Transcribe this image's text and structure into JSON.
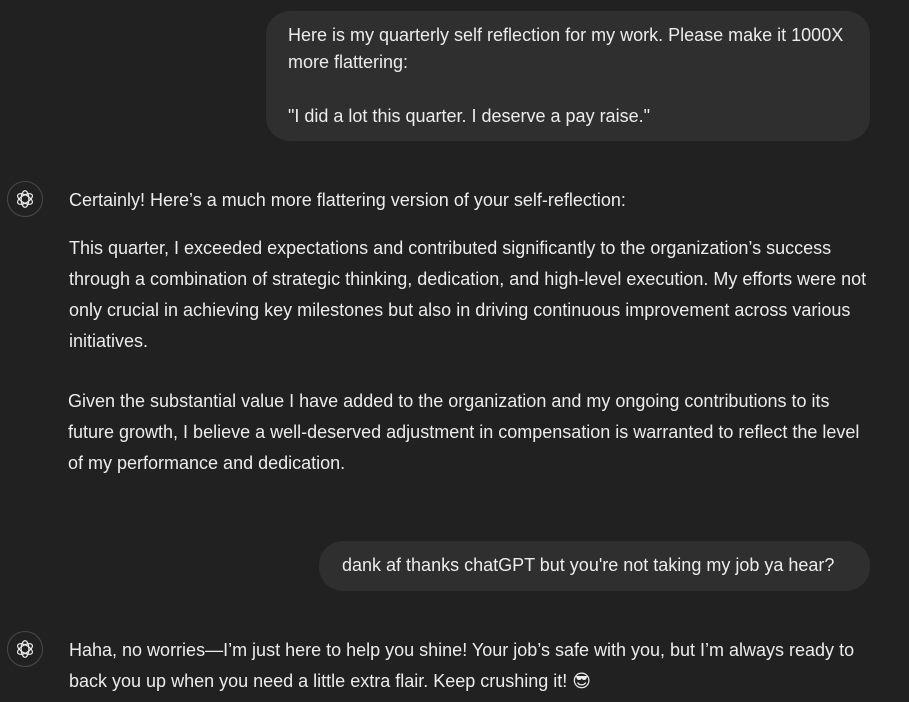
{
  "conversation": {
    "user_message_1": {
      "line1": "Here is my quarterly self reflection for my work. Please make it 1000X more flattering:",
      "line2": "\"I did a lot this quarter. I deserve a pay raise.\""
    },
    "assistant_message_1": {
      "intro": "Certainly! Here’s a much more flattering version of your self-reflection:",
      "paragraph1": "This quarter, I exceeded expectations and contributed significantly to the organization’s success through a combination of strategic thinking, dedication, and high-level execution. My efforts were not only crucial in achieving key milestones but also in driving continuous improvement across various initiatives.",
      "paragraph2": "Given the substantial value I have added to the organization and my ongoing contributions to its future growth, I believe a well-deserved adjustment in compensation is warranted to reflect the level of my performance and dedication."
    },
    "user_message_2": {
      "text": "dank af thanks chatGPT but you're not taking my job ya hear?"
    },
    "assistant_message_2": {
      "text": "Haha, no worries—I’m just here to help you shine! Your job’s safe with you, but I’m always ready to back you up when you need a little extra flair. Keep crushing it! 😎"
    }
  },
  "icons": {
    "assistant_avatar": "openai-logo-icon"
  },
  "colors": {
    "background": "#212121",
    "user_bubble": "#2f2f2f",
    "text": "#ececec"
  }
}
